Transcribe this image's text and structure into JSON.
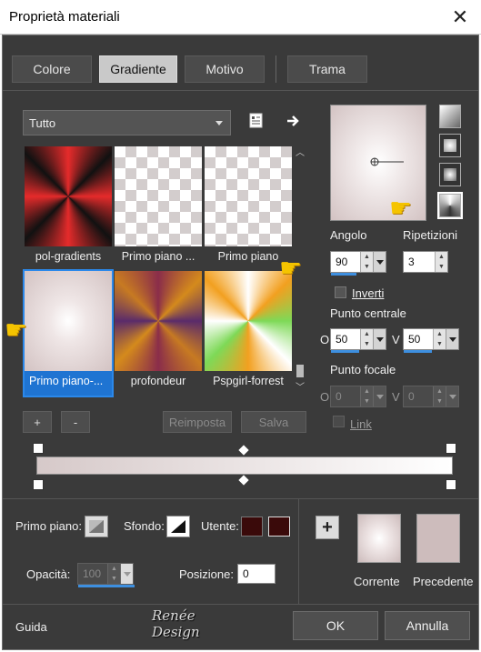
{
  "window": {
    "title": "Proprietà materiali"
  },
  "tabs": [
    "Colore",
    "Gradiente",
    "Motivo",
    "Trama"
  ],
  "active_tab": "Gradiente",
  "category": {
    "selected": "Tutto"
  },
  "gradients": [
    {
      "label": "pol-gradients"
    },
    {
      "label": "Primo piano ..."
    },
    {
      "label": "Primo piano"
    },
    {
      "label": "Primo piano-..."
    },
    {
      "label": "profondeur"
    },
    {
      "label": "Pspgirl-forrest"
    }
  ],
  "selected_gradient_index": 3,
  "list_buttons": {
    "add": "+",
    "remove": "-",
    "reset": "Reimposta",
    "save": "Salva"
  },
  "angle": {
    "label": "Angolo",
    "value": "90"
  },
  "repeats": {
    "label": "Ripetizioni",
    "value": "3"
  },
  "invert": {
    "label": "Inverti",
    "checked": false
  },
  "center_point": {
    "label": "Punto centrale",
    "o_label": "O",
    "v_label": "V",
    "o_value": "50",
    "v_value": "50"
  },
  "focal_point": {
    "label": "Punto focale",
    "o_label": "O",
    "v_label": "V",
    "o_value": "0",
    "v_value": "0"
  },
  "link": {
    "label": "Link",
    "checked": false
  },
  "gradient_bar": {
    "start_color": "#d6c9c9",
    "end_color": "#ffffff"
  },
  "foreground": {
    "label": "Primo piano:"
  },
  "background": {
    "label": "Sfondo:"
  },
  "user": {
    "label": "Utente:",
    "color": "#3a0a0a"
  },
  "opacity": {
    "label": "Opacità:",
    "value": "100"
  },
  "position": {
    "label": "Posizione:",
    "value": "0"
  },
  "preview": {
    "current_label": "Corrente",
    "previous_label": "Precedente",
    "previous_color": "#cdbcbc"
  },
  "footer": {
    "help": "Guida",
    "ok": "OK",
    "cancel": "Annulla",
    "watermark": "Renée Design"
  },
  "colors": {
    "dialog_bg": "#3a3a3a",
    "accent": "#2b88ea"
  }
}
